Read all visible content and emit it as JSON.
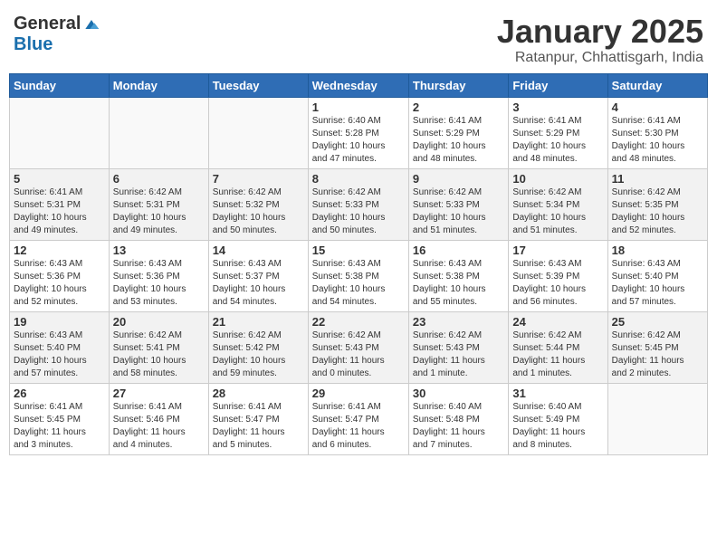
{
  "header": {
    "logo_general": "General",
    "logo_blue": "Blue",
    "month_title": "January 2025",
    "location": "Ratanpur, Chhattisgarh, India"
  },
  "weekdays": [
    "Sunday",
    "Monday",
    "Tuesday",
    "Wednesday",
    "Thursday",
    "Friday",
    "Saturday"
  ],
  "weeks": [
    [
      {
        "day": "",
        "info": ""
      },
      {
        "day": "",
        "info": ""
      },
      {
        "day": "",
        "info": ""
      },
      {
        "day": "1",
        "info": "Sunrise: 6:40 AM\nSunset: 5:28 PM\nDaylight: 10 hours\nand 47 minutes."
      },
      {
        "day": "2",
        "info": "Sunrise: 6:41 AM\nSunset: 5:29 PM\nDaylight: 10 hours\nand 48 minutes."
      },
      {
        "day": "3",
        "info": "Sunrise: 6:41 AM\nSunset: 5:29 PM\nDaylight: 10 hours\nand 48 minutes."
      },
      {
        "day": "4",
        "info": "Sunrise: 6:41 AM\nSunset: 5:30 PM\nDaylight: 10 hours\nand 48 minutes."
      }
    ],
    [
      {
        "day": "5",
        "info": "Sunrise: 6:41 AM\nSunset: 5:31 PM\nDaylight: 10 hours\nand 49 minutes."
      },
      {
        "day": "6",
        "info": "Sunrise: 6:42 AM\nSunset: 5:31 PM\nDaylight: 10 hours\nand 49 minutes."
      },
      {
        "day": "7",
        "info": "Sunrise: 6:42 AM\nSunset: 5:32 PM\nDaylight: 10 hours\nand 50 minutes."
      },
      {
        "day": "8",
        "info": "Sunrise: 6:42 AM\nSunset: 5:33 PM\nDaylight: 10 hours\nand 50 minutes."
      },
      {
        "day": "9",
        "info": "Sunrise: 6:42 AM\nSunset: 5:33 PM\nDaylight: 10 hours\nand 51 minutes."
      },
      {
        "day": "10",
        "info": "Sunrise: 6:42 AM\nSunset: 5:34 PM\nDaylight: 10 hours\nand 51 minutes."
      },
      {
        "day": "11",
        "info": "Sunrise: 6:42 AM\nSunset: 5:35 PM\nDaylight: 10 hours\nand 52 minutes."
      }
    ],
    [
      {
        "day": "12",
        "info": "Sunrise: 6:43 AM\nSunset: 5:36 PM\nDaylight: 10 hours\nand 52 minutes."
      },
      {
        "day": "13",
        "info": "Sunrise: 6:43 AM\nSunset: 5:36 PM\nDaylight: 10 hours\nand 53 minutes."
      },
      {
        "day": "14",
        "info": "Sunrise: 6:43 AM\nSunset: 5:37 PM\nDaylight: 10 hours\nand 54 minutes."
      },
      {
        "day": "15",
        "info": "Sunrise: 6:43 AM\nSunset: 5:38 PM\nDaylight: 10 hours\nand 54 minutes."
      },
      {
        "day": "16",
        "info": "Sunrise: 6:43 AM\nSunset: 5:38 PM\nDaylight: 10 hours\nand 55 minutes."
      },
      {
        "day": "17",
        "info": "Sunrise: 6:43 AM\nSunset: 5:39 PM\nDaylight: 10 hours\nand 56 minutes."
      },
      {
        "day": "18",
        "info": "Sunrise: 6:43 AM\nSunset: 5:40 PM\nDaylight: 10 hours\nand 57 minutes."
      }
    ],
    [
      {
        "day": "19",
        "info": "Sunrise: 6:43 AM\nSunset: 5:40 PM\nDaylight: 10 hours\nand 57 minutes."
      },
      {
        "day": "20",
        "info": "Sunrise: 6:42 AM\nSunset: 5:41 PM\nDaylight: 10 hours\nand 58 minutes."
      },
      {
        "day": "21",
        "info": "Sunrise: 6:42 AM\nSunset: 5:42 PM\nDaylight: 10 hours\nand 59 minutes."
      },
      {
        "day": "22",
        "info": "Sunrise: 6:42 AM\nSunset: 5:43 PM\nDaylight: 11 hours\nand 0 minutes."
      },
      {
        "day": "23",
        "info": "Sunrise: 6:42 AM\nSunset: 5:43 PM\nDaylight: 11 hours\nand 1 minute."
      },
      {
        "day": "24",
        "info": "Sunrise: 6:42 AM\nSunset: 5:44 PM\nDaylight: 11 hours\nand 1 minutes."
      },
      {
        "day": "25",
        "info": "Sunrise: 6:42 AM\nSunset: 5:45 PM\nDaylight: 11 hours\nand 2 minutes."
      }
    ],
    [
      {
        "day": "26",
        "info": "Sunrise: 6:41 AM\nSunset: 5:45 PM\nDaylight: 11 hours\nand 3 minutes."
      },
      {
        "day": "27",
        "info": "Sunrise: 6:41 AM\nSunset: 5:46 PM\nDaylight: 11 hours\nand 4 minutes."
      },
      {
        "day": "28",
        "info": "Sunrise: 6:41 AM\nSunset: 5:47 PM\nDaylight: 11 hours\nand 5 minutes."
      },
      {
        "day": "29",
        "info": "Sunrise: 6:41 AM\nSunset: 5:47 PM\nDaylight: 11 hours\nand 6 minutes."
      },
      {
        "day": "30",
        "info": "Sunrise: 6:40 AM\nSunset: 5:48 PM\nDaylight: 11 hours\nand 7 minutes."
      },
      {
        "day": "31",
        "info": "Sunrise: 6:40 AM\nSunset: 5:49 PM\nDaylight: 11 hours\nand 8 minutes."
      },
      {
        "day": "",
        "info": ""
      }
    ]
  ]
}
